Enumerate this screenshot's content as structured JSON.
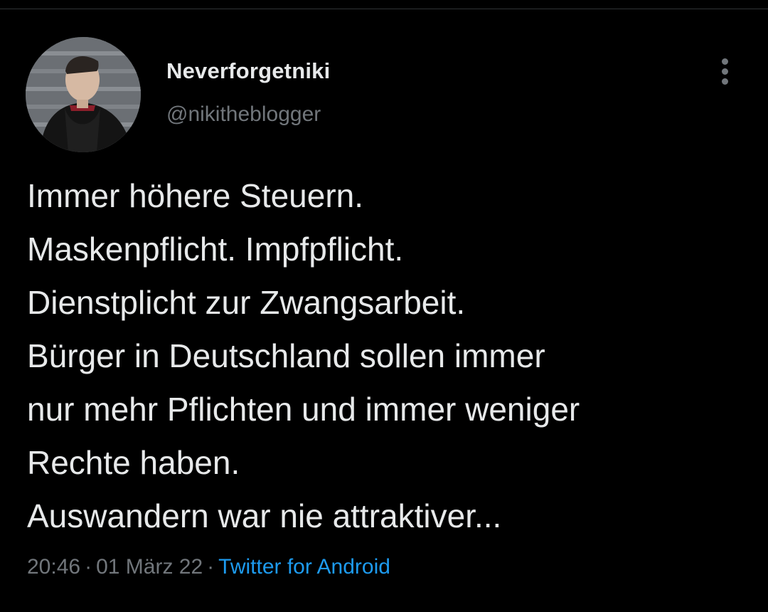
{
  "user": {
    "display_name": "Neverforgetniki",
    "handle": "@nikitheblogger"
  },
  "tweet": {
    "lines": [
      "Immer höhere Steuern.",
      "Maskenpflicht. Impfpflicht.",
      "Dienstplicht zur Zwangsarbeit.",
      "Bürger in Deutschland sollen immer",
      "nur mehr Pflichten und immer weniger",
      "Rechte haben.",
      "Auswandern war nie attraktiver..."
    ]
  },
  "meta": {
    "time": "20:46",
    "separator": "·",
    "date": "01 März 22",
    "source": "Twitter for Android"
  },
  "icons": {
    "more": "vertical-ellipsis-icon"
  },
  "colors": {
    "background": "#000000",
    "text_primary": "#e7e9ea",
    "text_secondary": "#71767b",
    "accent": "#1d9bf0"
  }
}
